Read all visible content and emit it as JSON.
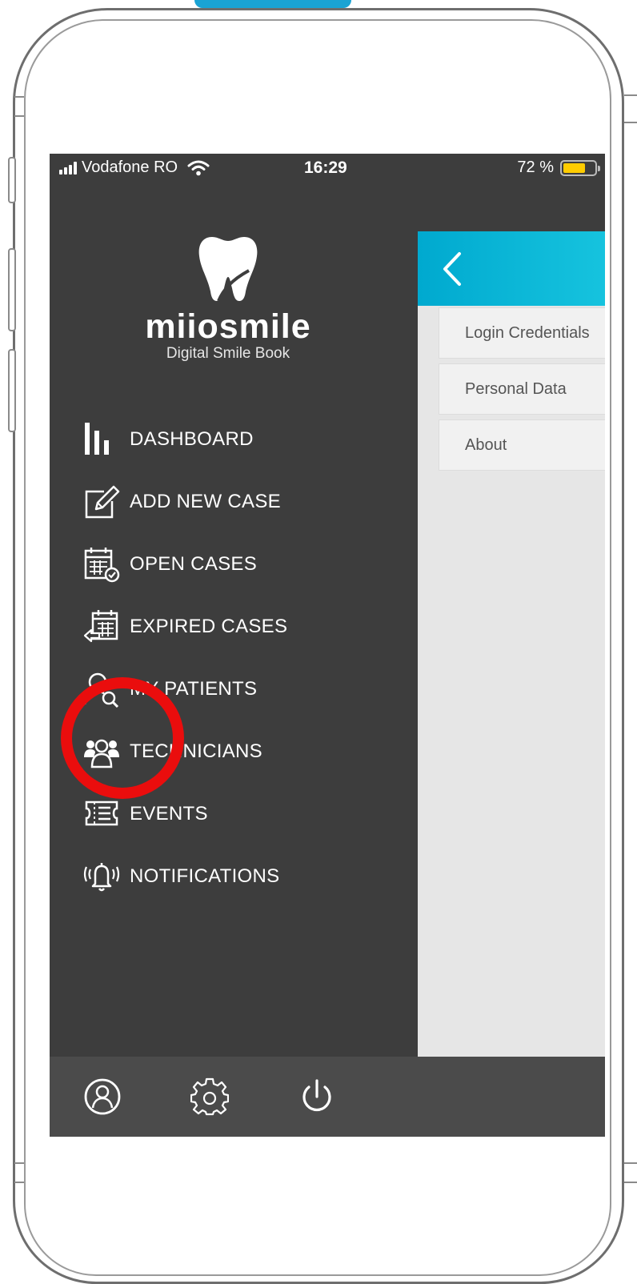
{
  "status_bar": {
    "carrier": "Vodafone RO",
    "time": "16:29",
    "battery_percent": "72 %",
    "battery_level": 0.72,
    "signal_icon": "signal-bars-icon",
    "wifi_icon": "wifi-icon"
  },
  "brand": {
    "name": "miiosmile",
    "tagline": "Digital Smile Book",
    "logo_icon": "tooth-icon"
  },
  "menu": {
    "items": [
      {
        "label": "DASHBOARD",
        "icon": "bar-chart-icon"
      },
      {
        "label": "ADD NEW CASE",
        "icon": "edit-icon"
      },
      {
        "label": "OPEN CASES",
        "icon": "calendar-check-icon"
      },
      {
        "label": "EXPIRED CASES",
        "icon": "calendar-back-icon"
      },
      {
        "label": "MY PATIENTS",
        "icon": "patient-search-icon"
      },
      {
        "label": "TECHNICIANS",
        "icon": "group-icon"
      },
      {
        "label": "EVENTS",
        "icon": "ticket-list-icon"
      },
      {
        "label": "NOTIFICATIONS",
        "icon": "ringing-bell-icon"
      }
    ]
  },
  "bottom_bar": {
    "icons": [
      "profile-icon",
      "gear-icon",
      "power-icon"
    ]
  },
  "panel": {
    "back_icon": "chevron-left-icon",
    "items": [
      "Login Credentials",
      "Personal Data",
      "About"
    ]
  },
  "colors": {
    "sidebar_bg": "#3d3d3d",
    "bottom_bar_bg": "#4b4b4b",
    "header_gradient_start": "#00a9cf",
    "header_gradient_end": "#16c3de",
    "highlight_circle": "#ea0d0d",
    "battery_fill": "#ffcc00"
  }
}
